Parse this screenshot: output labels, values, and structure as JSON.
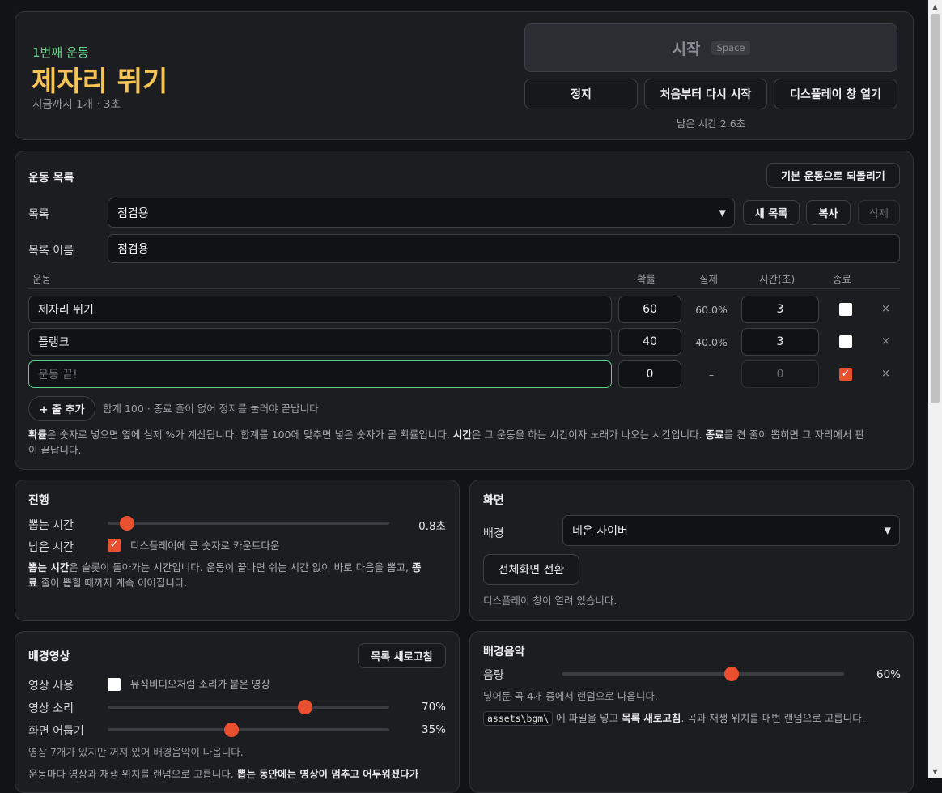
{
  "header": {
    "order_label": "1번째 운동",
    "current_exercise": "제자리 뛰기",
    "progress_text": "지금까지 1개 · 3초",
    "start_label": "시작",
    "start_hotkey": "Space",
    "stop_label": "정지",
    "restart_label": "처음부터 다시 시작",
    "open_display_label": "디스플레이 창 열기",
    "remaining_text": "남은 시간 2.6초"
  },
  "list_panel": {
    "title": "운동 목록",
    "reset_label": "기본 운동으로 되돌리기",
    "list_label": "목록",
    "list_selected": "점검용",
    "new_list_label": "새 목록",
    "copy_label": "복사",
    "delete_label": "삭제",
    "name_label": "목록 이름",
    "name_value": "점검용",
    "columns": {
      "exercise": "운동",
      "prob": "확률",
      "actual": "실제",
      "time": "시간(초)",
      "end": "종료"
    },
    "rows": [
      {
        "name": "제자리 뛰기",
        "prob": "60",
        "actual": "60.0%",
        "time": "3",
        "end": false,
        "remove": "×"
      },
      {
        "name": "플랭크",
        "prob": "40",
        "actual": "40.0%",
        "time": "3",
        "end": false,
        "remove": "×"
      },
      {
        "name": "",
        "placeholder": "운동 끝!",
        "prob": "0",
        "actual": "–",
        "time": "0",
        "end": true,
        "remove": "×"
      }
    ],
    "add_row_label": "+ 줄 추가",
    "sum_text": "합계 100 · 종료 줄이 없어 정지를 눌러야 끝납니다",
    "help": {
      "b1": "확률",
      "t1": "은 숫자로 넣으면 옆에 실제 %가 계산됩니다. 합계를 100에 맞추면 넣은 숫자가 곧 확률입니다. ",
      "b2": "시간",
      "t2": "은 그 운동을 하는 시간이자 노래가 나오는 시간입니다. ",
      "b3": "종료",
      "t3": "를 켠 줄이 뽑히면 그 자리에서 판",
      "t4": "이 끝납니다."
    }
  },
  "progress_panel": {
    "title": "진행",
    "draw_label": "뽑는 시간",
    "draw_value": "0.8초",
    "draw_level": 0.07,
    "remain_label": "남은 시간",
    "countdown_checked": true,
    "countdown_text": "디스플레이에 큰 숫자로 카운트다운",
    "note": {
      "b1": "뽑는 시간",
      "t1": "은 슬롯이 돌아가는 시간입니다. 운동이 끝나면 쉬는 시간 없이 바로 다음을 뽑고, ",
      "b2": "종",
      "b3": "료",
      "t2": " 줄이 뽑힐 때까지 계속 이어집니다."
    }
  },
  "screen_panel": {
    "title": "화면",
    "bg_label": "배경",
    "bg_value": "네온 사이버",
    "fullscreen_label": "전체화면 전환",
    "status": "디스플레이 창이 열려 있습니다."
  },
  "video_panel": {
    "title": "배경영상",
    "refresh_label": "목록 새로고침",
    "use_label": "영상 사용",
    "use_checked": false,
    "use_text": "뮤직비디오처럼 소리가 붙은 영상",
    "sound_label": "영상 소리",
    "sound_value": "70%",
    "sound_level": 0.7,
    "dim_label": "화면 어둡기",
    "dim_value": "35%",
    "dim_level": 0.44,
    "status": "영상 7개가 있지만 꺼져 있어 배경음악이 나옵니다.",
    "note": {
      "t1": "운동마다 영상과 재생 위치를 랜덤으로 고릅니다. ",
      "b1": "뽑는 동안에는 영상이 멈추고 어두워졌다가"
    }
  },
  "music_panel": {
    "title": "배경음악",
    "volume_label": "음량",
    "volume_value": "60%",
    "volume_level": 0.6,
    "status": "넣어둔 곡 4개 중에서 랜덤으로 나옵니다.",
    "path": "assets\\bgm\\",
    "note": {
      "t1": " 에 파일을 넣고 ",
      "b1": "목록 새로고침",
      "t2": ". 곡과 재생 위치를 매번 랜덤으로 고릅니다."
    }
  },
  "colors": {
    "accent": "#e8502f",
    "title_yellow": "#f6c453",
    "order_green": "#6fcf8e",
    "panel": "#1c1d21",
    "bg": "#121316"
  }
}
